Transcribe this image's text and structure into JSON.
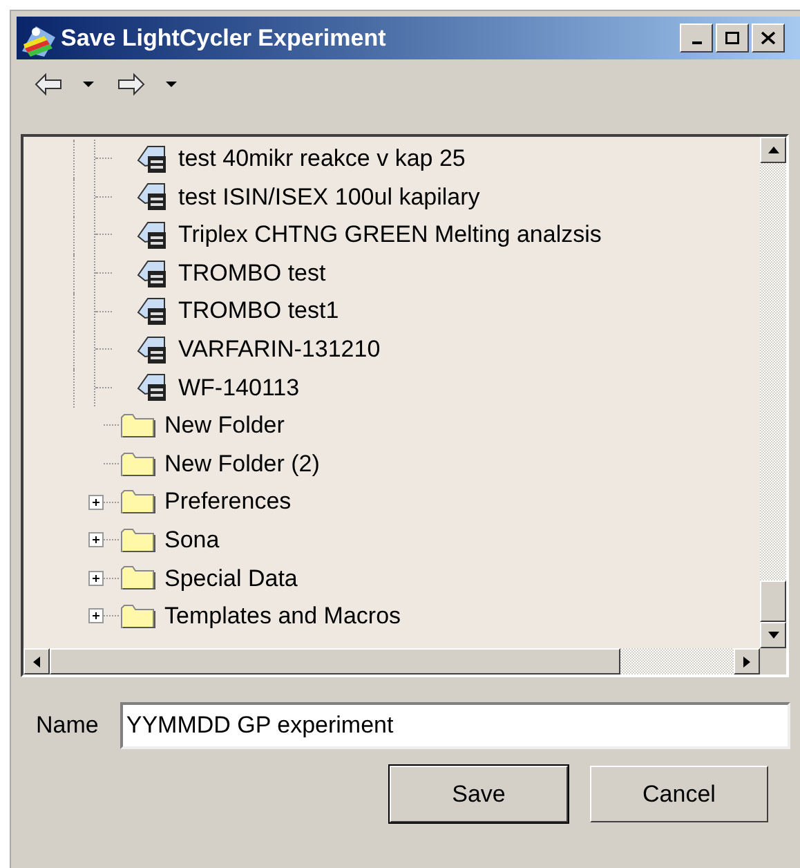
{
  "window": {
    "title": "Save LightCycler Experiment"
  },
  "toolbar": {
    "buttons": [
      {
        "kind": "back"
      },
      {
        "kind": "forward"
      }
    ]
  },
  "tree": {
    "items": [
      {
        "children": [
          {
            "label": "test 40mikr reakce v kap 25",
            "kind": "experiment"
          },
          {
            "label": "test ISIN/ISEX 100ul kapilary",
            "kind": "experiment"
          },
          {
            "label": "Triplex CHTNG GREEN Melting analzsis",
            "kind": "experiment"
          },
          {
            "label": "TROMBO test",
            "kind": "experiment"
          },
          {
            "label": "TROMBO test1",
            "kind": "experiment"
          },
          {
            "label": "VARFARIN-131210",
            "kind": "experiment"
          },
          {
            "label": "WF-140113",
            "kind": "experiment"
          }
        ]
      },
      {
        "label": "New Folder",
        "kind": "folder",
        "expandable": false
      },
      {
        "label": "New Folder (2)",
        "kind": "folder",
        "expandable": false
      },
      {
        "label": "Preferences",
        "kind": "folder",
        "expandable": true
      },
      {
        "label": "Sona",
        "kind": "folder",
        "expandable": true
      },
      {
        "label": "Special Data",
        "kind": "folder",
        "expandable": true
      },
      {
        "label": "Templates and Macros",
        "kind": "folder",
        "expandable": true
      }
    ]
  },
  "name_field": {
    "label": "Name",
    "value": "YYMMDD GP experiment"
  },
  "buttons": [
    {
      "label": "Save",
      "default": true
    },
    {
      "label": "Cancel",
      "default": false
    }
  ]
}
